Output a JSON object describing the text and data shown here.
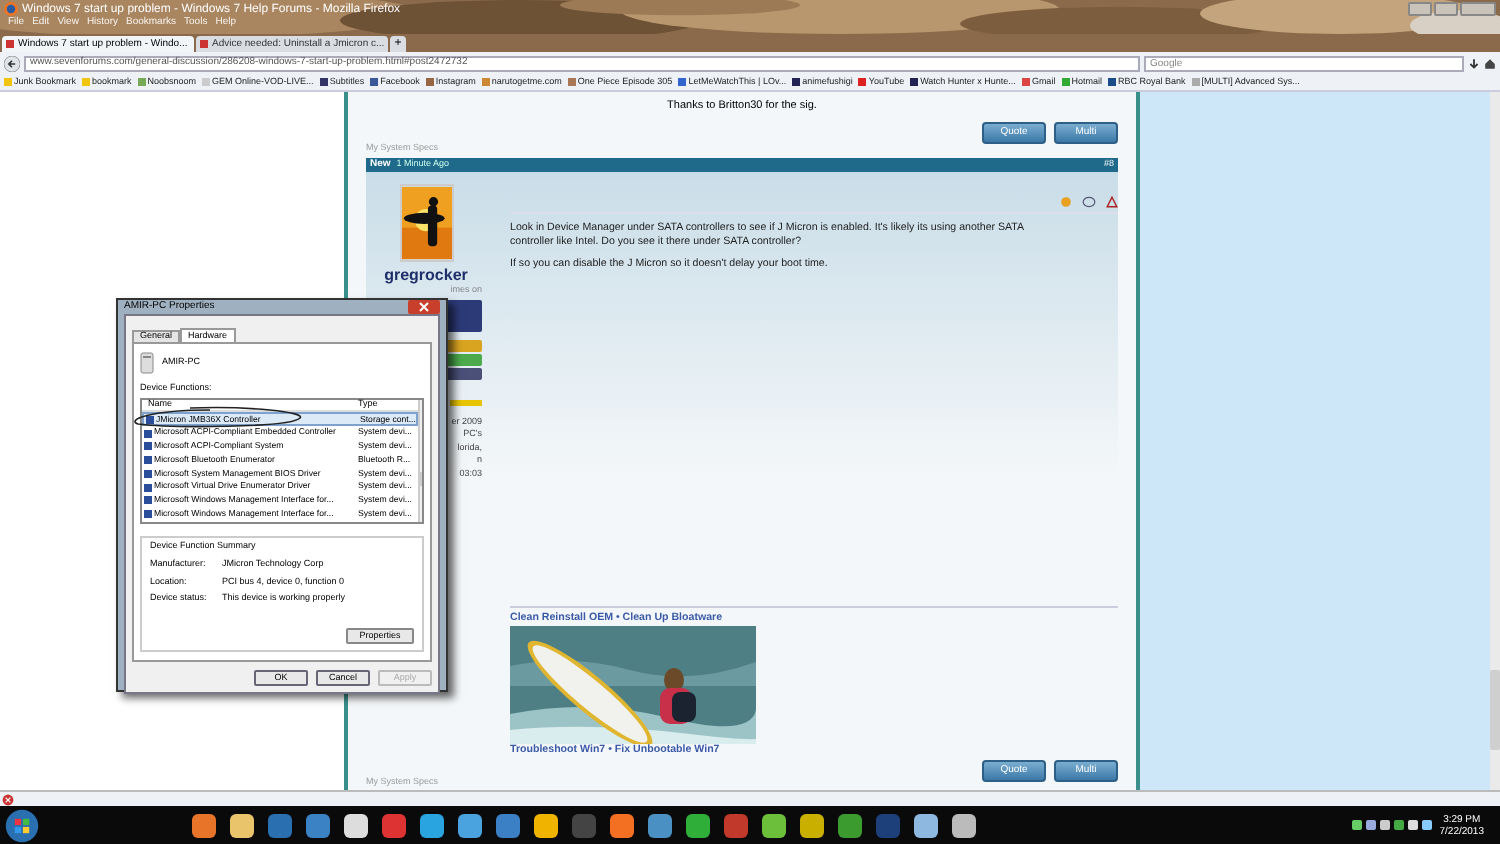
{
  "window": {
    "title": "Windows 7 start up problem - Windows 7 Help Forums - Mozilla Firefox",
    "menu": [
      "File",
      "Edit",
      "View",
      "History",
      "Bookmarks",
      "Tools",
      "Help"
    ]
  },
  "tabs": [
    {
      "label": "Windows 7 start up problem - Windo...",
      "selected": true
    },
    {
      "label": "Advice needed: Uninstall a Jmicron c...",
      "selected": false
    }
  ],
  "new_tab": "+",
  "address": "www.sevenforums.com/general-discussion/286208-windows-7-start-up-problem.html#post2472732",
  "search": {
    "placeholder": "Google"
  },
  "bookmarks": [
    "Junk Bookmark",
    "bookmark",
    "Noobsnoom",
    "GEM Online-VOD-LIVE...",
    "Subtitles",
    "Facebook",
    "Instagram",
    "narutogetme.com",
    "One Piece Episode 305",
    "LetMeWatchThis | LOv...",
    "animefushigi",
    "YouTube",
    "Watch Hunter x Hunte...",
    "Gmail",
    "Hotmail",
    "RBC Royal Bank",
    "[MULTI] Advanced Sys..."
  ],
  "forum": {
    "prev_post": {
      "signature": "Thanks to Britton30 for the sig.",
      "buttons": [
        "Quote",
        "Multi"
      ],
      "specs": "My System Specs"
    },
    "post": {
      "badge": "New",
      "time": "1 Minute Ago",
      "number": "#8",
      "author": "gregrocker",
      "author_sub": "imes on",
      "sidebar": [
        "er 2009",
        "PC's",
        "lorida,",
        "n",
        "03:03"
      ],
      "body": [
        "Look in Device Manager under SATA controllers to see if J Micron is enabled. It's likely its using another SATA controller like Intel. Do you see it there under SATA controller?",
        "If so you can disable the J Micron so it doesn't delay your boot time."
      ],
      "sig_top": "Clean Reinstall OEM • Clean Up Bloatware",
      "sig_bottom": "Troubleshoot Win7 • Fix Unbootable Win7",
      "buttons": [
        "Quote",
        "Multi"
      ],
      "specs": "My System Specs"
    }
  },
  "dialog": {
    "title": "AMIR-PC Properties",
    "tabs": [
      {
        "label": "General",
        "selected": false
      },
      {
        "label": "Hardware",
        "selected": true
      }
    ],
    "device": "AMIR-PC",
    "functions_label": "Device Functions:",
    "columns": [
      "Name",
      "Type"
    ],
    "rows": [
      {
        "name": "JMicron JMB36X Controller",
        "type": "Storage cont...",
        "selected": true
      },
      {
        "name": "Microsoft ACPI-Compliant Embedded Controller",
        "type": "System devi...",
        "selected": false
      },
      {
        "name": "Microsoft ACPI-Compliant System",
        "type": "System devi...",
        "selected": false
      },
      {
        "name": "Microsoft Bluetooth Enumerator",
        "type": "Bluetooth R...",
        "selected": false
      },
      {
        "name": "Microsoft System Management BIOS Driver",
        "type": "System devi...",
        "selected": false
      },
      {
        "name": "Microsoft Virtual Drive Enumerator Driver",
        "type": "System devi...",
        "selected": false
      },
      {
        "name": "Microsoft Windows Management Interface for...",
        "type": "System devi...",
        "selected": false
      },
      {
        "name": "Microsoft Windows Management Interface for...",
        "type": "System devi...",
        "selected": false
      }
    ],
    "summary_label": "Device Function Summary",
    "summary": [
      {
        "label": "Manufacturer:",
        "value": "JMicron Technology Corp"
      },
      {
        "label": "Location:",
        "value": "PCI bus 4, device 0, function 0"
      },
      {
        "label": "Device status:",
        "value": "This device is working properly"
      }
    ],
    "properties_button": "Properties",
    "buttons": [
      {
        "label": "OK",
        "disabled": false
      },
      {
        "label": "Cancel",
        "disabled": false
      },
      {
        "label": "Apply",
        "disabled": true
      }
    ]
  },
  "taskbar": {
    "time": "3:29 PM",
    "date": "7/22/2013"
  }
}
